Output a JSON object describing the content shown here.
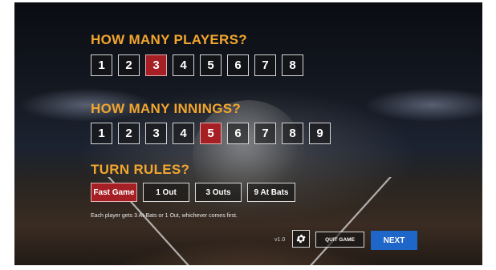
{
  "players": {
    "heading": "HOW MANY PLAYERS?",
    "options": [
      "1",
      "2",
      "3",
      "4",
      "5",
      "6",
      "7",
      "8"
    ],
    "selected": "3"
  },
  "innings": {
    "heading": "HOW MANY INNINGS?",
    "options": [
      "1",
      "2",
      "3",
      "4",
      "5",
      "6",
      "7",
      "8",
      "9"
    ],
    "selected": "5"
  },
  "rules": {
    "heading": "TURN RULES?",
    "options": [
      "Fast Game",
      "1 Out",
      "3 Outs",
      "9 At Bats"
    ],
    "selected": "Fast Game",
    "description": "Each player gets 3 At-Bats or 1 Out, whichever comes first."
  },
  "footer": {
    "version": "v1.0",
    "settings_icon": "gear-icon",
    "quit_label": "QUIT GAME",
    "next_label": "NEXT"
  },
  "colors": {
    "heading": "#f2a62e",
    "selected": "#a61f24",
    "next": "#1f66c9"
  }
}
